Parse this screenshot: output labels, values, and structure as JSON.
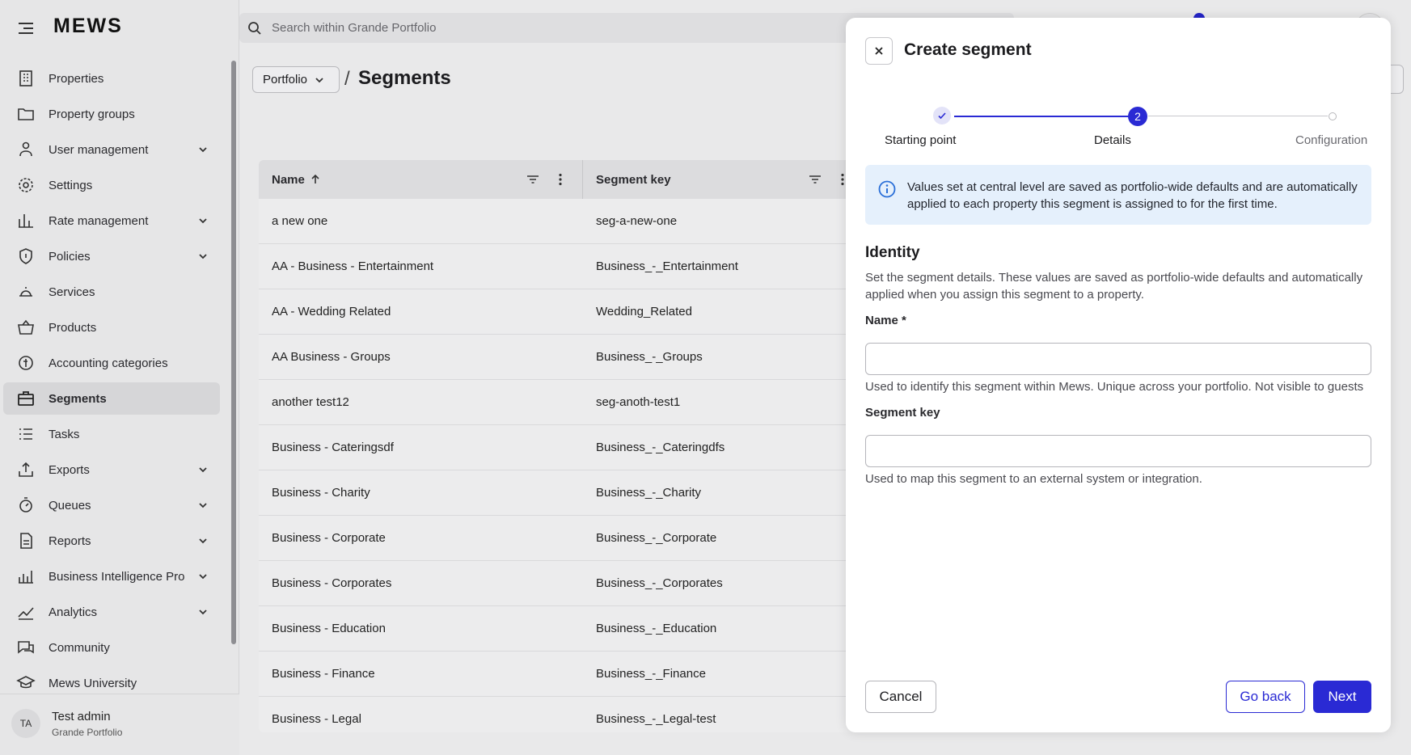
{
  "app": {
    "logo": "MEWS"
  },
  "search": {
    "placeholder": "Search within Grande Portfolio"
  },
  "sidebar": {
    "items": [
      {
        "label": "Properties",
        "icon": "building-icon",
        "has_chevron": false
      },
      {
        "label": "Property groups",
        "icon": "folder-icon",
        "has_chevron": false
      },
      {
        "label": "User management",
        "icon": "users-icon",
        "has_chevron": true
      },
      {
        "label": "Settings",
        "icon": "gear-icon",
        "has_chevron": false
      },
      {
        "label": "Rate management",
        "icon": "bar-chart-icon",
        "has_chevron": true
      },
      {
        "label": "Policies",
        "icon": "shield-icon",
        "has_chevron": true
      },
      {
        "label": "Services",
        "icon": "bell-icon",
        "has_chevron": false
      },
      {
        "label": "Products",
        "icon": "basket-icon",
        "has_chevron": false
      },
      {
        "label": "Accounting categories",
        "icon": "coins-icon",
        "has_chevron": false
      },
      {
        "label": "Segments",
        "icon": "briefcase-icon",
        "has_chevron": false,
        "active": true
      },
      {
        "label": "Tasks",
        "icon": "list-icon",
        "has_chevron": false
      },
      {
        "label": "Exports",
        "icon": "upload-icon",
        "has_chevron": true
      },
      {
        "label": "Queues",
        "icon": "timer-icon",
        "has_chevron": true
      },
      {
        "label": "Reports",
        "icon": "document-icon",
        "has_chevron": true
      },
      {
        "label": "Business Intelligence Pro",
        "icon": "bi-chart-icon",
        "has_chevron": true
      },
      {
        "label": "Analytics",
        "icon": "line-chart-icon",
        "has_chevron": true
      },
      {
        "label": "Community",
        "icon": "chat-icon",
        "has_chevron": false
      },
      {
        "label": "Mews University",
        "icon": "graduation-icon",
        "has_chevron": false
      }
    ],
    "user": {
      "initials": "TA",
      "name": "Test admin",
      "org": "Grande Portfolio"
    }
  },
  "main": {
    "breadcrumb_root": "Portfolio",
    "separator": "/",
    "title": "Segments",
    "table": {
      "columns": [
        "Name",
        "Segment key"
      ],
      "rows": [
        [
          "a new one",
          "seg-a-new-one"
        ],
        [
          "AA - Business - Entertainment",
          "Business_-_Entertainment"
        ],
        [
          "AA - Wedding Related",
          "Wedding_Related"
        ],
        [
          "AA Business - Groups",
          "Business_-_Groups"
        ],
        [
          "another test12",
          "seg-anoth-test1"
        ],
        [
          "Business - Cateringsdf",
          "Business_-_Cateringdfs"
        ],
        [
          "Business - Charity",
          "Business_-_Charity"
        ],
        [
          "Business - Corporate",
          "Business_-_Corporate"
        ],
        [
          "Business - Corporates",
          "Business_-_Corporates"
        ],
        [
          "Business - Education",
          "Business_-_Education"
        ],
        [
          "Business - Finance",
          "Business_-_Finance"
        ],
        [
          "Business - Legal",
          "Business_-_Legal-test"
        ]
      ]
    }
  },
  "drawer": {
    "title": "Create segment",
    "steps": [
      {
        "label": "Starting point",
        "state": "done"
      },
      {
        "label": "Details",
        "state": "current",
        "number": "2"
      },
      {
        "label": "Configuration",
        "state": "todo"
      }
    ],
    "info": "Values set at central level are saved as portfolio-wide defaults and are automatically applied to each property this segment is assigned to for the first time.",
    "section_title": "Identity",
    "section_desc": "Set the segment details. These values are saved as portfolio-wide defaults and automatically applied when you assign this segment to a property.",
    "name_label": "Name *",
    "name_value": "",
    "name_help": "Used to identify this segment within Mews. Unique across your portfolio. Not visible to guests",
    "key_label": "Segment key",
    "key_value": "",
    "key_help": "Used to map this segment to an external system or integration.",
    "cancel_label": "Cancel",
    "back_label": "Go back",
    "next_label": "Next"
  },
  "colors": {
    "accent": "#2a2ad4",
    "info_bg": "#e5f0fc"
  }
}
